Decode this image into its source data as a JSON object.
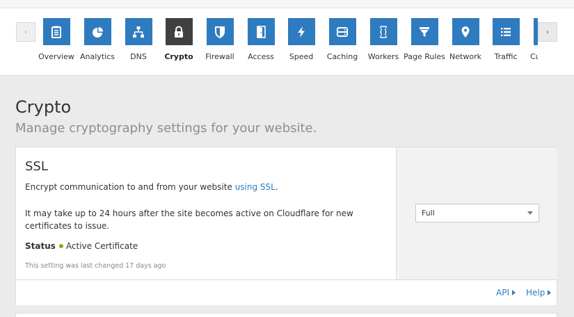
{
  "nav": {
    "items": [
      {
        "label": "Overview",
        "icon": "clipboard-icon"
      },
      {
        "label": "Analytics",
        "icon": "pie-chart-icon"
      },
      {
        "label": "DNS",
        "icon": "network-tree-icon"
      },
      {
        "label": "Crypto",
        "icon": "lock-icon",
        "active": true
      },
      {
        "label": "Firewall",
        "icon": "shield-icon"
      },
      {
        "label": "Access",
        "icon": "door-icon"
      },
      {
        "label": "Speed",
        "icon": "lightning-icon"
      },
      {
        "label": "Caching",
        "icon": "server-icon"
      },
      {
        "label": "Workers",
        "icon": "code-braces-icon"
      },
      {
        "label": "Page Rules",
        "icon": "filter-icon"
      },
      {
        "label": "Network",
        "icon": "location-pin-icon"
      },
      {
        "label": "Traffic",
        "icon": "list-icon"
      },
      {
        "label": "Cu",
        "icon": "custom-icon"
      }
    ],
    "prev_arrow": "‹",
    "next_arrow": "›"
  },
  "page": {
    "title": "Crypto",
    "subtitle": "Manage cryptography settings for your website."
  },
  "ssl_card": {
    "title": "SSL",
    "description_prefix": "Encrypt communication to and from your website ",
    "description_link": "using SSL",
    "description_suffix": ".",
    "note": "It may take up to 24 hours after the site becomes active on Cloudflare for new certificates to issue.",
    "status_label": "Status",
    "status_value": "Active Certificate",
    "last_changed": "This setting was last changed 17 days ago",
    "mode_selected": "Full",
    "footer_api": "API",
    "footer_help": "Help"
  },
  "colors": {
    "accent": "#2f7bbf",
    "active_tab": "#404041",
    "status_ok": "#79a927"
  }
}
